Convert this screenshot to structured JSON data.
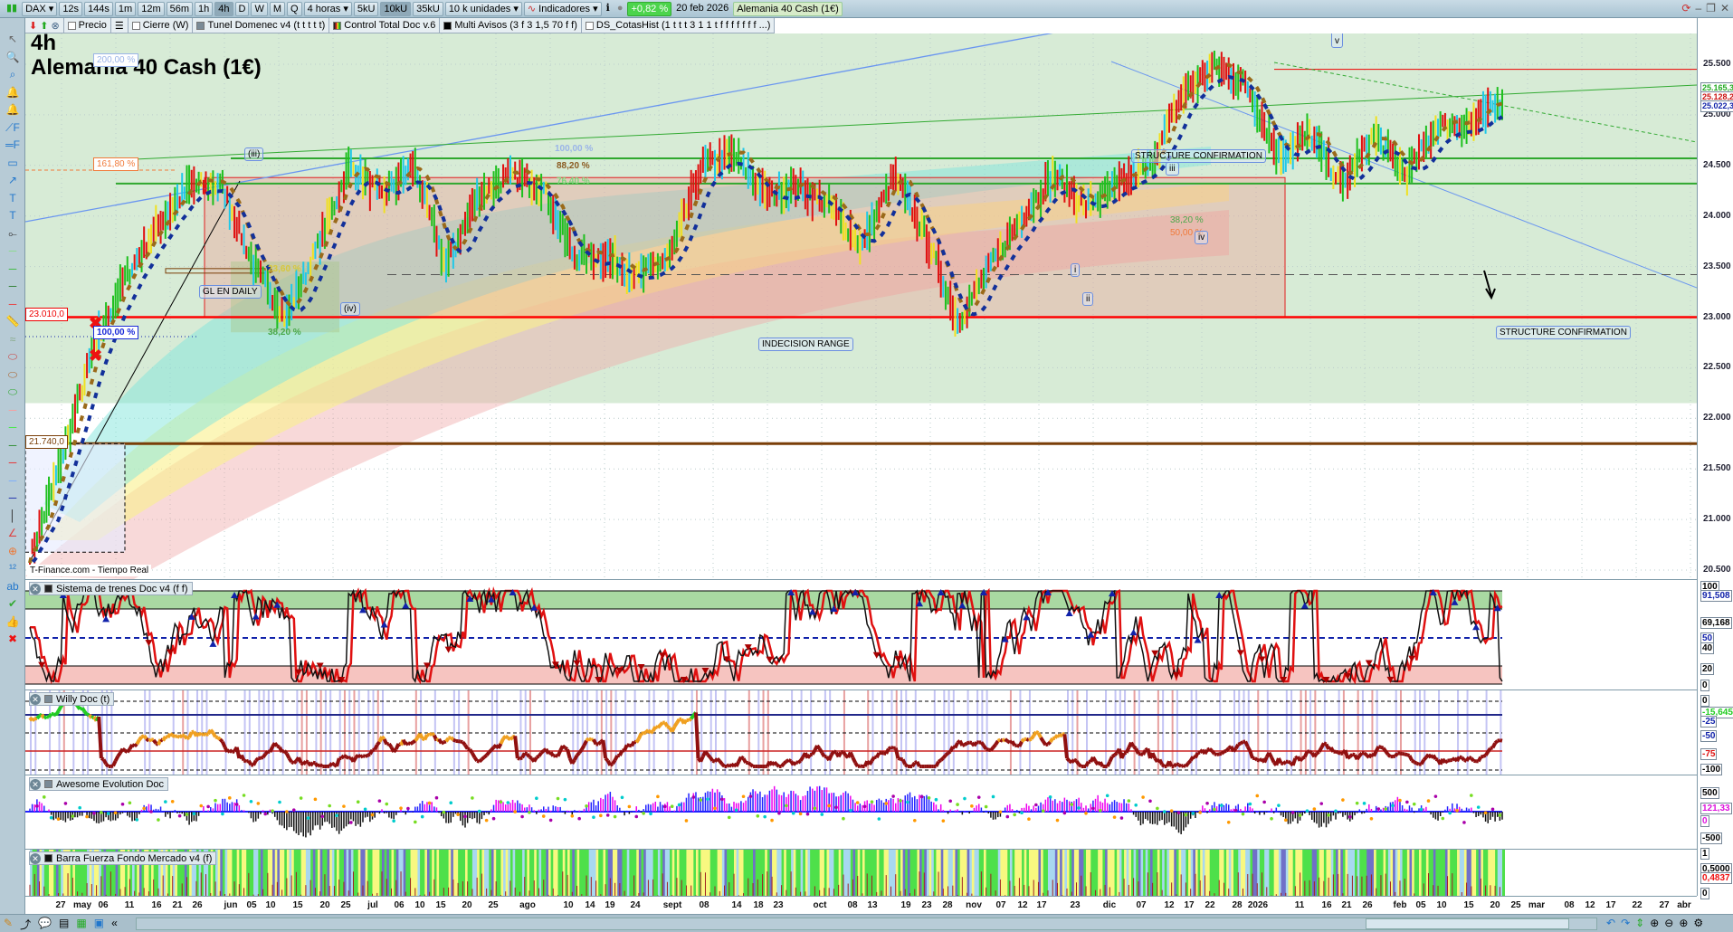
{
  "toolbar": {
    "symbol": "DAX",
    "timeframes": [
      "12s",
      "144s",
      "1m",
      "12m",
      "56m",
      "1h",
      "4h",
      "D",
      "W",
      "M",
      "Q"
    ],
    "selected_timeframe": "4h",
    "period_select": "4 horas",
    "units": [
      "5kU",
      "10kU",
      "35kU"
    ],
    "selected_unit": "10kU",
    "units_select": "10 k unidades",
    "indicators_label": "Indicadores",
    "change": "+0,82 %",
    "date": "20 feb 2026",
    "instrument": "Alemania 40 Cash (1€)"
  },
  "indicator_bar": [
    "Precio",
    "Cierre (W)",
    "Tunel Domenec v4 (t t t t t)",
    "Control Total Doc v.6",
    "Multi Avisos (3 f 3 1,5 70 f f)",
    "DS_CotasHist (1 t t t 3 1 1 t f f f f f f f ...)"
  ],
  "chart": {
    "timeframe_title": "4h",
    "title": "Alemania 40 Cash (1€)",
    "source": "T-Finance.com - Tiempo Real",
    "price_axis": [
      "25.500",
      "25.000",
      "24.500",
      "24.000",
      "23.500",
      "23.000",
      "22.500",
      "22.000",
      "21.500",
      "21.000",
      "20.500"
    ],
    "price_axis_values": [
      25500,
      25000,
      24500,
      24000,
      23500,
      23000,
      22500,
      22000,
      21500,
      21000,
      20500
    ],
    "last_prices": {
      "green": "25.165,3",
      "red": "25.128,2",
      "blue": "25.022,3"
    },
    "level_labels": {
      "high": "23.010,0",
      "low": "21.740,0"
    },
    "fib_labels": {
      "f200": "200,00 %",
      "f161": "161,80 %",
      "f100": "100,00 %",
      "f382": "38,20 %",
      "f236": "23,60 %",
      "g100": "100,00 %",
      "g882": "88,20 %",
      "g764": "76,40 %",
      "h382": "38,20 %",
      "h50": "50,00 %"
    },
    "annotations": {
      "wave_iii_paren": "(iii)",
      "wave_iv_paren": "(iv)",
      "gl_daily": "GL EN DAILY",
      "indecision": "INDECISION RANGE",
      "structure1": "STRUCTURE CONFIRMATION",
      "structure2": "STRUCTURE CONFIRMATION",
      "wave_i": "i",
      "wave_ii": "ii",
      "wave_iii": "iii",
      "wave_iv": "iv",
      "wave_v": "v"
    },
    "price_path": [
      20600,
      21600,
      22700,
      23400,
      23900,
      24300,
      24300,
      23500,
      23000,
      23700,
      24500,
      24200,
      24500,
      23500,
      24200,
      24400,
      24300,
      23600,
      23600,
      23400,
      23600,
      24500,
      24600,
      24200,
      24300,
      24100,
      23700,
      24400,
      23800,
      22950,
      23500,
      24000,
      24400,
      24100,
      24300,
      24500,
      25200,
      25480,
      25300,
      24600,
      24800,
      24300,
      24800,
      24400,
      24900,
      24900,
      25130
    ],
    "colors": {
      "bg_green": "#d7ebd6",
      "range_red": "#e02020",
      "support_red": "#ff0000",
      "brown": "#7a3e08",
      "green_line": "#2fa82f",
      "blue_line": "#6a96f0"
    }
  },
  "panels": [
    {
      "name": "Sistema de trenes Doc v4 (f f)",
      "axis": [
        "100",
        "91,508",
        "69,168",
        "50",
        "40",
        "20",
        "0"
      ]
    },
    {
      "name": "Willy Doc (t)",
      "axis": [
        "0",
        "-15,645",
        "-25",
        "-50",
        "-75",
        "-100"
      ]
    },
    {
      "name": "Awesome Evolution Doc",
      "axis": [
        "500",
        "121,33",
        "0",
        "-500"
      ]
    },
    {
      "name": "Barra Fuerza Fondo Mercado v4 (f)",
      "axis": [
        "1",
        "0,5000",
        "0,4837",
        "0"
      ]
    }
  ],
  "dates": [
    "27",
    "may",
    "06",
    "11",
    "16",
    "21",
    "26",
    "jun",
    "05",
    "10",
    "15",
    "20",
    "25",
    "jul",
    "06",
    "10",
    "15",
    "20",
    "25",
    "ago",
    "10",
    "14",
    "19",
    "24",
    "sept",
    "08",
    "14",
    "18",
    "23",
    "oct",
    "08",
    "13",
    "19",
    "23",
    "28",
    "nov",
    "07",
    "12",
    "17",
    "23",
    "dic",
    "07",
    "12",
    "17",
    "22",
    "28",
    "2026",
    "11",
    "16",
    "21",
    "26",
    "feb",
    "05",
    "10",
    "15",
    "20",
    "25",
    "mar",
    "08",
    "12",
    "17",
    "22",
    "27",
    "abr"
  ],
  "left_tools": [
    "pointer-icon",
    "zoom-icon",
    "zoom-area-icon",
    "alert-add-icon",
    "alert-icon",
    "fibonacci-fan-icon",
    "fibonacci-level-icon",
    "rectangle-icon",
    "line-icon",
    "text-icon",
    "text-box-icon",
    "segment-icon",
    "horizontal-line-icon",
    "horizontal-line-green-icon",
    "horizontal-line-dark-icon",
    "horizontal-line-red-icon",
    "ruler-icon",
    "band-icon",
    "ellipse-red-icon",
    "ellipse-brown-icon",
    "ellipse-green-icon",
    "line-pink-icon",
    "line-lime-icon",
    "line-green-icon",
    "line-red-icon",
    "line-lightblue-icon",
    "line-navy-icon",
    "vertical-line-icon",
    "angle-icon",
    "circle-add-icon",
    "elliott-count-icon",
    "abc-count-icon",
    "check-icon",
    "thumbs-up-icon",
    "delete-icon"
  ]
}
